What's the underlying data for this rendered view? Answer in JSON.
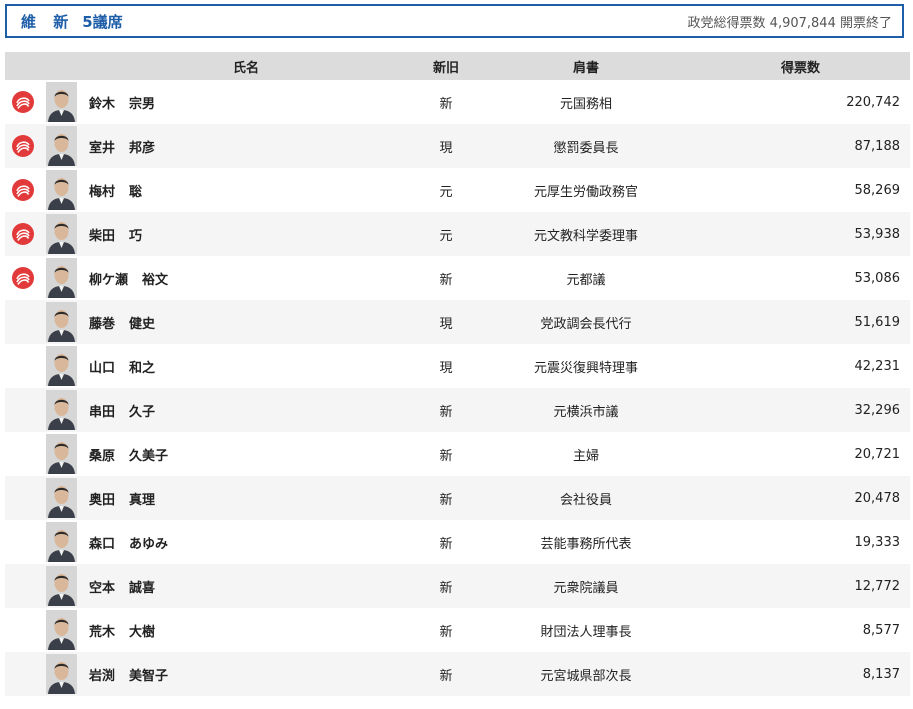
{
  "party": {
    "name": "維 新",
    "seats": "5議席",
    "total_votes_label": "政党総得票数",
    "total_votes": "4,907,844",
    "status": "開票終了"
  },
  "columns": {
    "name": "氏名",
    "status": "新旧",
    "title": "肩書",
    "votes": "得票数"
  },
  "colors": {
    "accent": "#1e5ea8",
    "elected": "#e23a3a",
    "header_bg": "#dcdcdc"
  },
  "candidates": [
    {
      "surname": "鈴木",
      "given": "宗男",
      "status": "新",
      "title": "元国務相",
      "votes": "220,742",
      "elected": true
    },
    {
      "surname": "室井",
      "given": "邦彦",
      "status": "現",
      "title": "懲罰委員長",
      "votes": "87,188",
      "elected": true
    },
    {
      "surname": "梅村",
      "given": "聡",
      "status": "元",
      "title": "元厚生労働政務官",
      "votes": "58,269",
      "elected": true
    },
    {
      "surname": "柴田",
      "given": "巧",
      "status": "元",
      "title": "元文教科学委理事",
      "votes": "53,938",
      "elected": true
    },
    {
      "surname": "柳ケ瀬",
      "given": "裕文",
      "status": "新",
      "title": "元都議",
      "votes": "53,086",
      "elected": true
    },
    {
      "surname": "藤巻",
      "given": "健史",
      "status": "現",
      "title": "党政調会長代行",
      "votes": "51,619",
      "elected": false
    },
    {
      "surname": "山口",
      "given": "和之",
      "status": "現",
      "title": "元震災復興特理事",
      "votes": "42,231",
      "elected": false
    },
    {
      "surname": "串田",
      "given": "久子",
      "status": "新",
      "title": "元横浜市議",
      "votes": "32,296",
      "elected": false
    },
    {
      "surname": "桑原",
      "given": "久美子",
      "status": "新",
      "title": "主婦",
      "votes": "20,721",
      "elected": false
    },
    {
      "surname": "奥田",
      "given": "真理",
      "status": "新",
      "title": "会社役員",
      "votes": "20,478",
      "elected": false
    },
    {
      "surname": "森口",
      "given": "あゆみ",
      "status": "新",
      "title": "芸能事務所代表",
      "votes": "19,333",
      "elected": false
    },
    {
      "surname": "空本",
      "given": "誠喜",
      "status": "新",
      "title": "元衆院議員",
      "votes": "12,772",
      "elected": false
    },
    {
      "surname": "荒木",
      "given": "大樹",
      "status": "新",
      "title": "財団法人理事長",
      "votes": "8,577",
      "elected": false
    },
    {
      "surname": "岩渕",
      "given": "美智子",
      "status": "新",
      "title": "元宮城県部次長",
      "votes": "8,137",
      "elected": false
    }
  ]
}
